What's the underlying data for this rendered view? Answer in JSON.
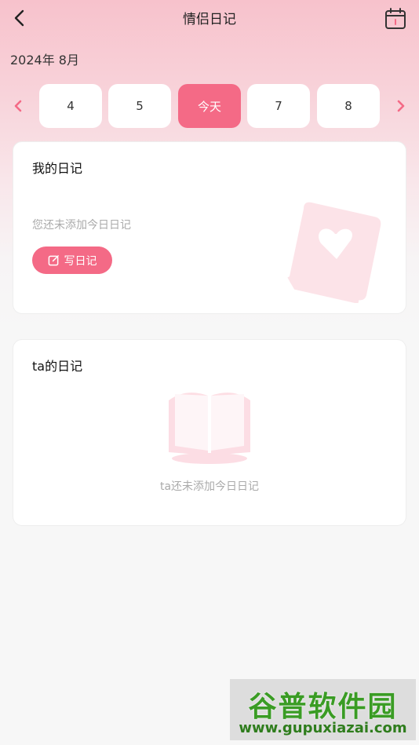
{
  "header": {
    "title": "情侣日记",
    "back_icon": "back-arrow-icon",
    "calendar_icon": "calendar-icon"
  },
  "month_label": "2024年   8月",
  "date_strip": {
    "days": [
      {
        "label": "4",
        "active": false
      },
      {
        "label": "5",
        "active": false
      },
      {
        "label": "今天",
        "active": true
      },
      {
        "label": "7",
        "active": false
      },
      {
        "label": "8",
        "active": false
      }
    ]
  },
  "my_diary": {
    "title": "我的日记",
    "empty_text": "您还未添加今日日记",
    "write_button": "写日记"
  },
  "ta_diary": {
    "title": "ta的日记",
    "empty_text": "ta还未添加今日日记"
  },
  "watermark": {
    "title": "谷普软件园",
    "url": "www.gupuxiazai.com"
  },
  "colors": {
    "accent": "#f46a86",
    "header_gradient_top": "#f7c2cc"
  }
}
